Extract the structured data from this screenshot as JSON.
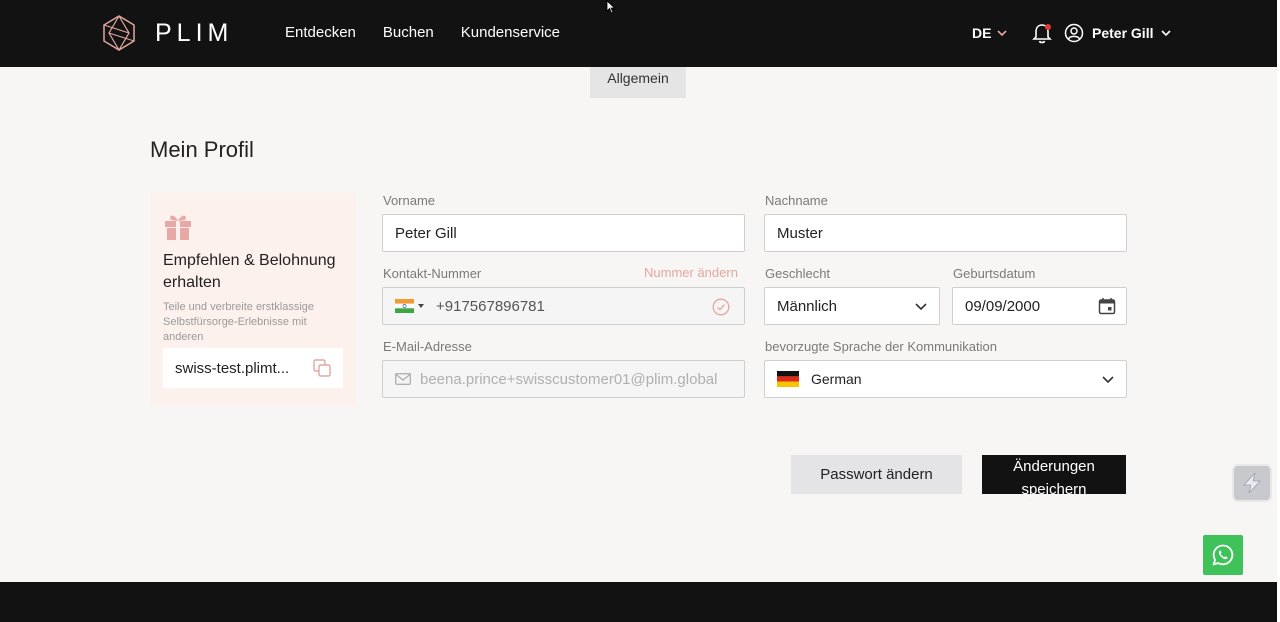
{
  "header": {
    "brand": "PLIM",
    "nav": [
      "Entdecken",
      "Buchen",
      "Kundenservice"
    ],
    "language": "DE",
    "user_name": "Peter Gill"
  },
  "tabs": {
    "active": "Allgemein"
  },
  "page": {
    "title": "Mein Profil"
  },
  "referral": {
    "title": "Empfehlen & Belohnung erhalten",
    "description": "Teile und verbreite erstklassige Selbstfürsorge-Erlebnisse mit anderen",
    "code": "swiss-test.plimt..."
  },
  "form": {
    "first_name": {
      "label": "Vorname",
      "value": "Peter Gill"
    },
    "last_name": {
      "label": "Nachname",
      "value": "Muster"
    },
    "phone": {
      "label": "Kontakt-Nummer",
      "change_link": "Nummer ändern",
      "value": "+917567896781"
    },
    "gender": {
      "label": "Geschlecht",
      "value": "Männlich"
    },
    "birthdate": {
      "label": "Geburtsdatum",
      "value": "09/09/2000"
    },
    "email": {
      "label": "E-Mail-Adresse",
      "value": "beena.prince+swisscustomer01@plim.global"
    },
    "language": {
      "label": "bevorzugte Sprache der Kommunikation",
      "value": "German"
    }
  },
  "actions": {
    "change_password": "Passwort ändern",
    "save_changes": "Änderungen speichern"
  },
  "colors": {
    "header_bg": "#121212",
    "accent": "#e3a79f",
    "referral_bg": "#fdf1ee",
    "whatsapp": "#3fc25a"
  }
}
